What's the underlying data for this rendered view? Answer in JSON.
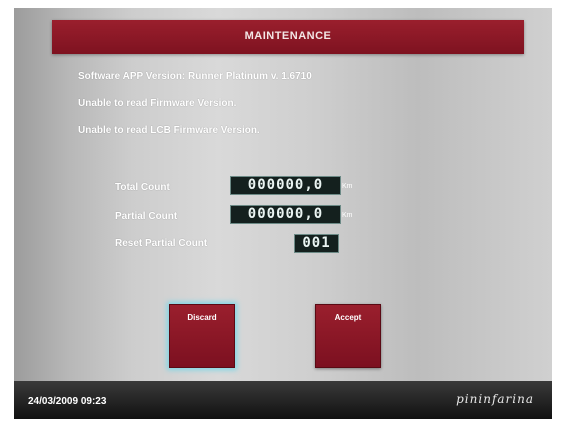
{
  "title": "MAINTENANCE",
  "info": {
    "software_version": "Software APP Version: Runner Platinum v. 1.6710",
    "firmware_error": "Unable to read Firmware Version.",
    "lcb_error": "Unable to read LCB Firmware Version."
  },
  "counts": {
    "total_label": "Total Count",
    "total_value": "000000,0",
    "total_unit": "Km",
    "partial_label": "Partial Count",
    "partial_value": "000000,0",
    "partial_unit": "Km",
    "reset_label": "Reset Partial Count",
    "reset_value": "001"
  },
  "buttons": {
    "discard_label": "Discard",
    "accept_label": "Accept"
  },
  "footer": {
    "datetime": "24/03/2009 09:23",
    "logo": "pininfarina"
  },
  "colors": {
    "accent_red": "#8c1626",
    "display_bg": "#14201e",
    "focus_glow": "#7fd6e6"
  }
}
